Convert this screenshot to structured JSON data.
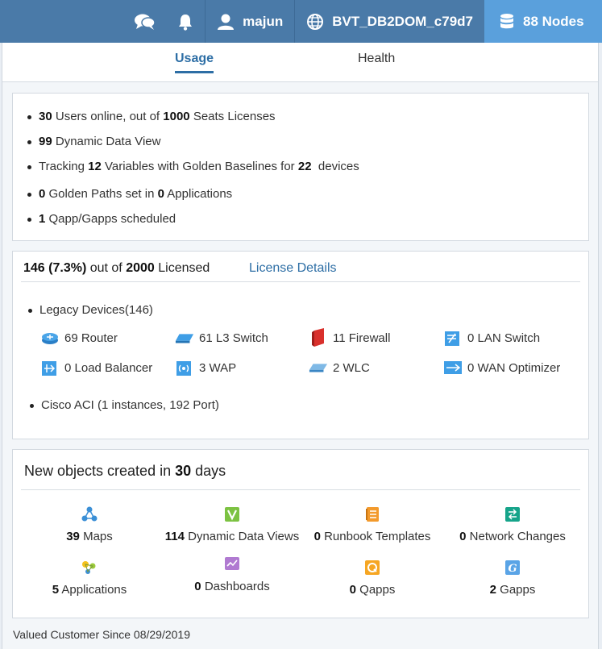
{
  "topbar": {
    "user": "majun",
    "domain": "BVT_DB2DOM_c79d7",
    "nodes": "88 Nodes",
    "icons": [
      "chat-icon",
      "bell-icon",
      "user-icon",
      "globe-icon",
      "database-icon"
    ]
  },
  "tabs": [
    {
      "label": "Usage",
      "active": true
    },
    {
      "label": "Health",
      "active": false
    }
  ],
  "usage": {
    "users_online": "30",
    "users_mid": "Users online, out of",
    "seats": "1000",
    "seats_suffix": "Seats Licenses",
    "ddv_count": "99",
    "ddv_label": "Dynamic Data View",
    "tracking_prefix": "Tracking",
    "variables": "12",
    "variables_mid": "Variables with Golden Baselines for",
    "devices": "22",
    "devices_suffix": "devices",
    "golden_paths": "0",
    "golden_mid": "Golden Paths set in",
    "applications": "0",
    "applications_suffix": "Applications",
    "qapp_count": "1",
    "qapp_label": "Qapp/Gapps scheduled"
  },
  "license": {
    "used": "146 (7.3%)",
    "mid": "out of",
    "total": "2000",
    "suffix": "Licensed",
    "details_link": "License Details",
    "legacy_label": "Legacy Devices(146)",
    "devices": [
      {
        "label": "69 Router",
        "icon": "router-icon"
      },
      {
        "label": "61 L3 Switch",
        "icon": "l3-switch-icon"
      },
      {
        "label": "11 Firewall",
        "icon": "firewall-icon"
      },
      {
        "label": "0 LAN Switch",
        "icon": "lan-switch-icon"
      },
      {
        "label": "0 Load Balancer",
        "icon": "load-balancer-icon"
      },
      {
        "label": "3 WAP",
        "icon": "wap-icon"
      },
      {
        "label": "2 WLC",
        "icon": "wlc-icon"
      },
      {
        "label": "0 WAN Optimizer",
        "icon": "wan-optimizer-icon"
      }
    ],
    "aci_label": "Cisco ACI (1 instances, 192 Port)"
  },
  "objects": {
    "title_prefix": "New objects created in",
    "days": "30",
    "title_suffix": "days",
    "items": [
      {
        "count": "39",
        "label": "Maps",
        "icon": "maps-icon",
        "color": "#3b8fd6"
      },
      {
        "count": "114",
        "label": "Dynamic Data Views",
        "icon": "ddv-icon",
        "color": "#7cc242"
      },
      {
        "count": "0",
        "label": "Runbook Templates",
        "icon": "runbook-icon",
        "color": "#f39a2c"
      },
      {
        "count": "0",
        "label": "Network Changes",
        "icon": "network-changes-icon",
        "color": "#16a48a"
      },
      {
        "count": "5",
        "label": "Applications",
        "icon": "applications-icon",
        "color": "#9ccb3b"
      },
      {
        "count": "0",
        "label": "Dashboards",
        "icon": "dashboards-icon",
        "color": "#b07ad1"
      },
      {
        "count": "0",
        "label": "Qapps",
        "icon": "qapps-icon",
        "color": "#f6a623"
      },
      {
        "count": "2",
        "label": "Gapps",
        "icon": "gapps-icon",
        "color": "#5aa4e6"
      }
    ]
  },
  "footer": "Valued Customer Since 08/29/2019"
}
